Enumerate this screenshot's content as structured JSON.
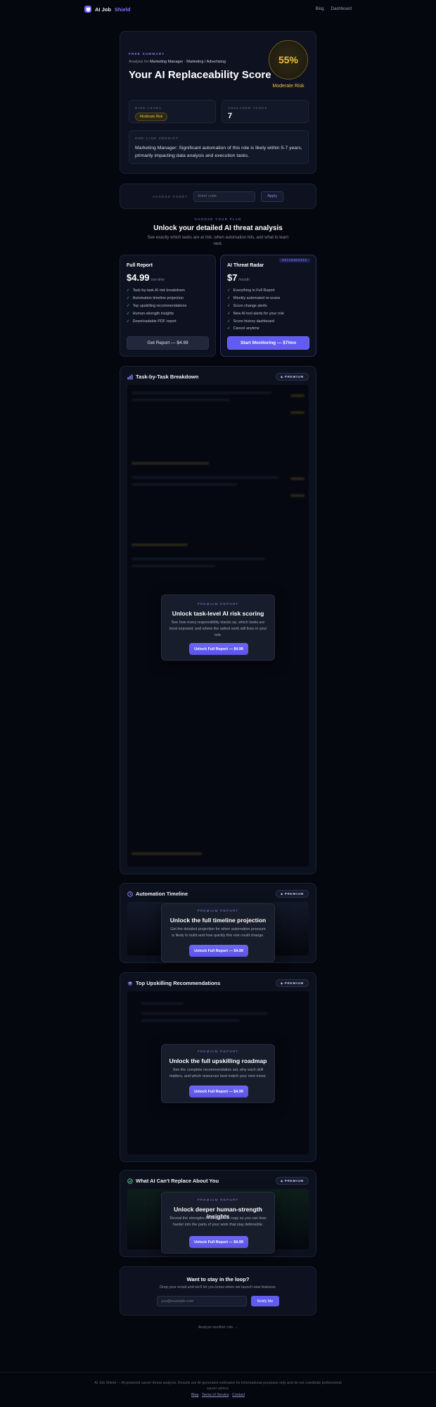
{
  "nav": {
    "brand_main": "AI Job",
    "brand_accent": "Shield",
    "links": [
      "Blog",
      "Dashboard"
    ]
  },
  "summary": {
    "eyebrow": "FREE SUMMARY",
    "analysis_prefix": "Analysis for",
    "analysis_role": "Marketing Manager · Marketing / Advertising",
    "title": "Your AI Replaceability Score",
    "score_percent": "55%",
    "score_fraction": 0.55,
    "score_label": "Moderate Risk",
    "risk_level_label": "RISK LEVEL",
    "risk_level_value": "Moderate Risk",
    "analyzed_tasks_label": "ANALYZED TASKS",
    "analyzed_tasks_value": "7",
    "verdict_label": "ONE-LINE VERDICT",
    "verdict_text": "Marketing Manager: Significant automation of this role is likely within 5-7 years, primarily impacting data analysis and execution tasks."
  },
  "access": {
    "label": "ACCESS CODE?",
    "placeholder": "Enter code",
    "apply": "Apply"
  },
  "plans": {
    "eyebrow": "CHOOSE YOUR PLAN",
    "title": "Unlock your detailed AI threat analysis",
    "subtitle": "See exactly which tasks are at risk, when automation hits, and what to learn next.",
    "full": {
      "name": "Full Report",
      "price": "$4.99",
      "unit": "one-time",
      "features": [
        "Task-by-task AI risk breakdown",
        "Automation timeline projection",
        "Top upskilling recommendations",
        "Human-strength insights",
        "Downloadable PDF report"
      ],
      "button": "Get Report — $4.99"
    },
    "radar": {
      "badge": "RECOMMENDED",
      "name": "AI Threat Radar",
      "price": "$7",
      "unit": "/month",
      "features": [
        "Everything in Full Report",
        "Weekly automated re-scans",
        "Score change alerts",
        "New AI tool alerts for your role",
        "Score history dashboard",
        "Cancel anytime"
      ],
      "button": "Start Monitoring — $7/mo"
    }
  },
  "sections": [
    {
      "title": "Task-by-Task Breakdown",
      "badge": "PREMIUM",
      "eyebrow": "PREMIUM REPORT",
      "overlay_title": "Unlock task-level AI risk scoring",
      "overlay_desc": "See how every responsibility stacks up, which tasks are most exposed, and where the safest work still lives in your role.",
      "button": "Unlock Full Report — $4.99"
    },
    {
      "title": "Automation Timeline",
      "badge": "PREMIUM",
      "eyebrow": "PREMIUM REPORT",
      "overlay_title": "Unlock the full timeline projection",
      "overlay_desc": "Get the detailed projection for when automation pressure is likely to build and how quickly this role could change.",
      "button": "Unlock Full Report — $4.99"
    },
    {
      "title": "Top Upskilling Recommendations",
      "badge": "PREMIUM",
      "eyebrow": "PREMIUM REPORT",
      "overlay_title": "Unlock the full upskilling roadmap",
      "overlay_desc": "See the complete recommendation set, why each skill matters, and which resources best match your next move.",
      "button": "Unlock Full Report — $4.99"
    },
    {
      "title": "What AI Can't Replace About You",
      "badge": "PREMIUM",
      "eyebrow": "PREMIUM REPORT",
      "overlay_title": "Unlock deeper human-strength insights",
      "overlay_desc": "Reveal the strengths AI struggles to copy so you can lean harder into the parts of your work that stay defensible.",
      "button": "Unlock Full Report — $4.99"
    }
  ],
  "newsletter": {
    "title": "Want to stay in the loop?",
    "subtitle": "Drop your email and we'll let you know when we launch new features.",
    "placeholder": "you@example.com",
    "button": "Notify Me"
  },
  "analyze_another": "Analyze another role →",
  "footer": {
    "disclaimer": "AI Job Shield — AI-powered career threat analysis. Results are AI-generated estimates for informational purposes only and do not constitute professional career advice.",
    "links": [
      "Blog",
      "Terms of Service",
      "Contact"
    ]
  },
  "colors": {
    "background": "#05070e",
    "accent": "#625bf0",
    "risk_yellow": "#f0c038"
  }
}
